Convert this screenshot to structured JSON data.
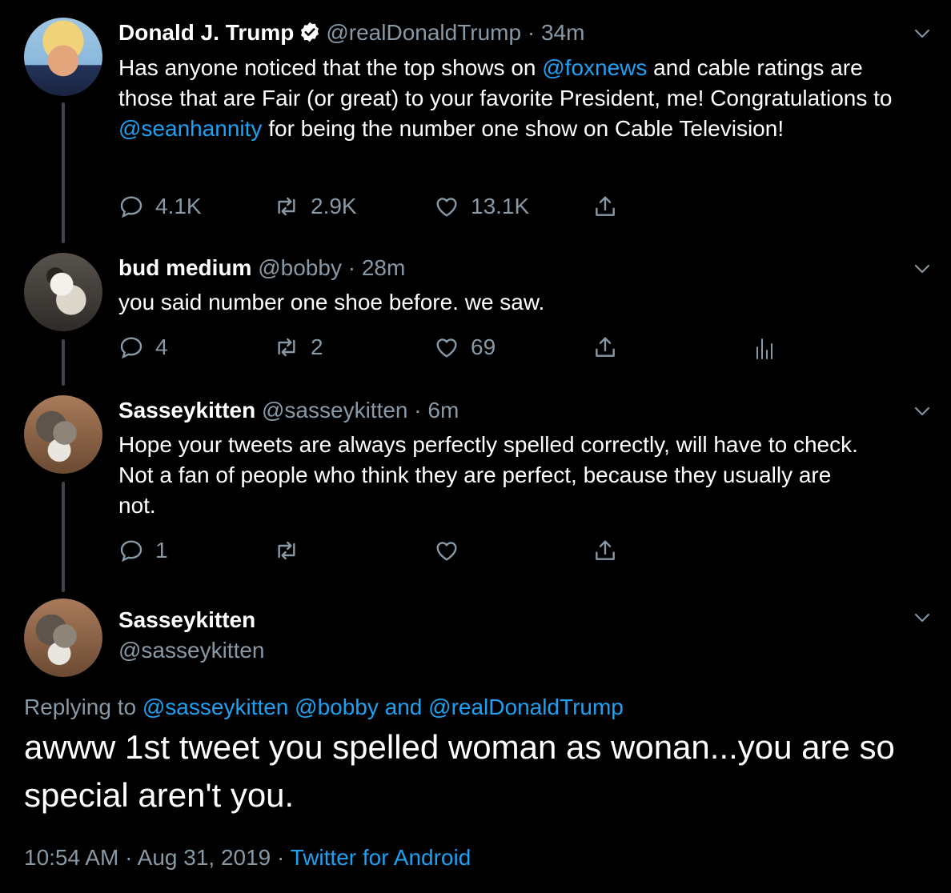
{
  "tweets": [
    {
      "name": "Donald J. Trump",
      "handle": "@realDonaldTrump",
      "dot": "·",
      "time": "34m",
      "text_parts": [
        {
          "t": "Has anyone noticed that the top shows on "
        },
        {
          "t": "@foxnews",
          "m": true
        },
        {
          "t": " and cable ratings are those that are Fair (or great) to your favorite President, me! Congratulations to "
        },
        {
          "t": "@seanhannity",
          "m": true
        },
        {
          "t": " for being the number one show on Cable Television!"
        }
      ],
      "replies": "4.1K",
      "retweets": "2.9K",
      "likes": "13.1K"
    },
    {
      "name": "bud medium",
      "handle": "@bobby",
      "dot": "·",
      "time": "28m",
      "text": "you said number one shoe before. we saw.",
      "replies": "4",
      "retweets": "2",
      "likes": "69"
    },
    {
      "name": "Sasseykitten",
      "handle": "@sasseykitten",
      "dot": "·",
      "time": "6m",
      "text": "Hope your tweets are always perfectly spelled correctly, will have to check. Not a fan of people who think they are perfect, because they usually are not.",
      "replies": "1",
      "retweets": "",
      "likes": ""
    }
  ],
  "main": {
    "name": "Sasseykitten",
    "handle": "@sasseykitten",
    "replying_prefix": "Replying to",
    "replying_1": "@sasseykitten",
    "replying_2": "@bobby",
    "replying_and": "and",
    "replying_3": "@realDonaldTrump",
    "text": "awww 1st tweet you spelled woman as wonan...you are so special aren't you.",
    "time": "10:54 AM",
    "sep": "·",
    "date": "Aug 31, 2019",
    "source": "Twitter for Android"
  },
  "colors": {
    "background": "#000000",
    "text": "#ffffff",
    "secondary": "#8899a6",
    "link": "#1da1f2",
    "thread_line": "#3d4650"
  },
  "icons": [
    "verified-badge-icon",
    "chevron-down-icon",
    "reply-icon",
    "retweet-icon",
    "like-icon",
    "share-icon",
    "analytics-icon"
  ]
}
